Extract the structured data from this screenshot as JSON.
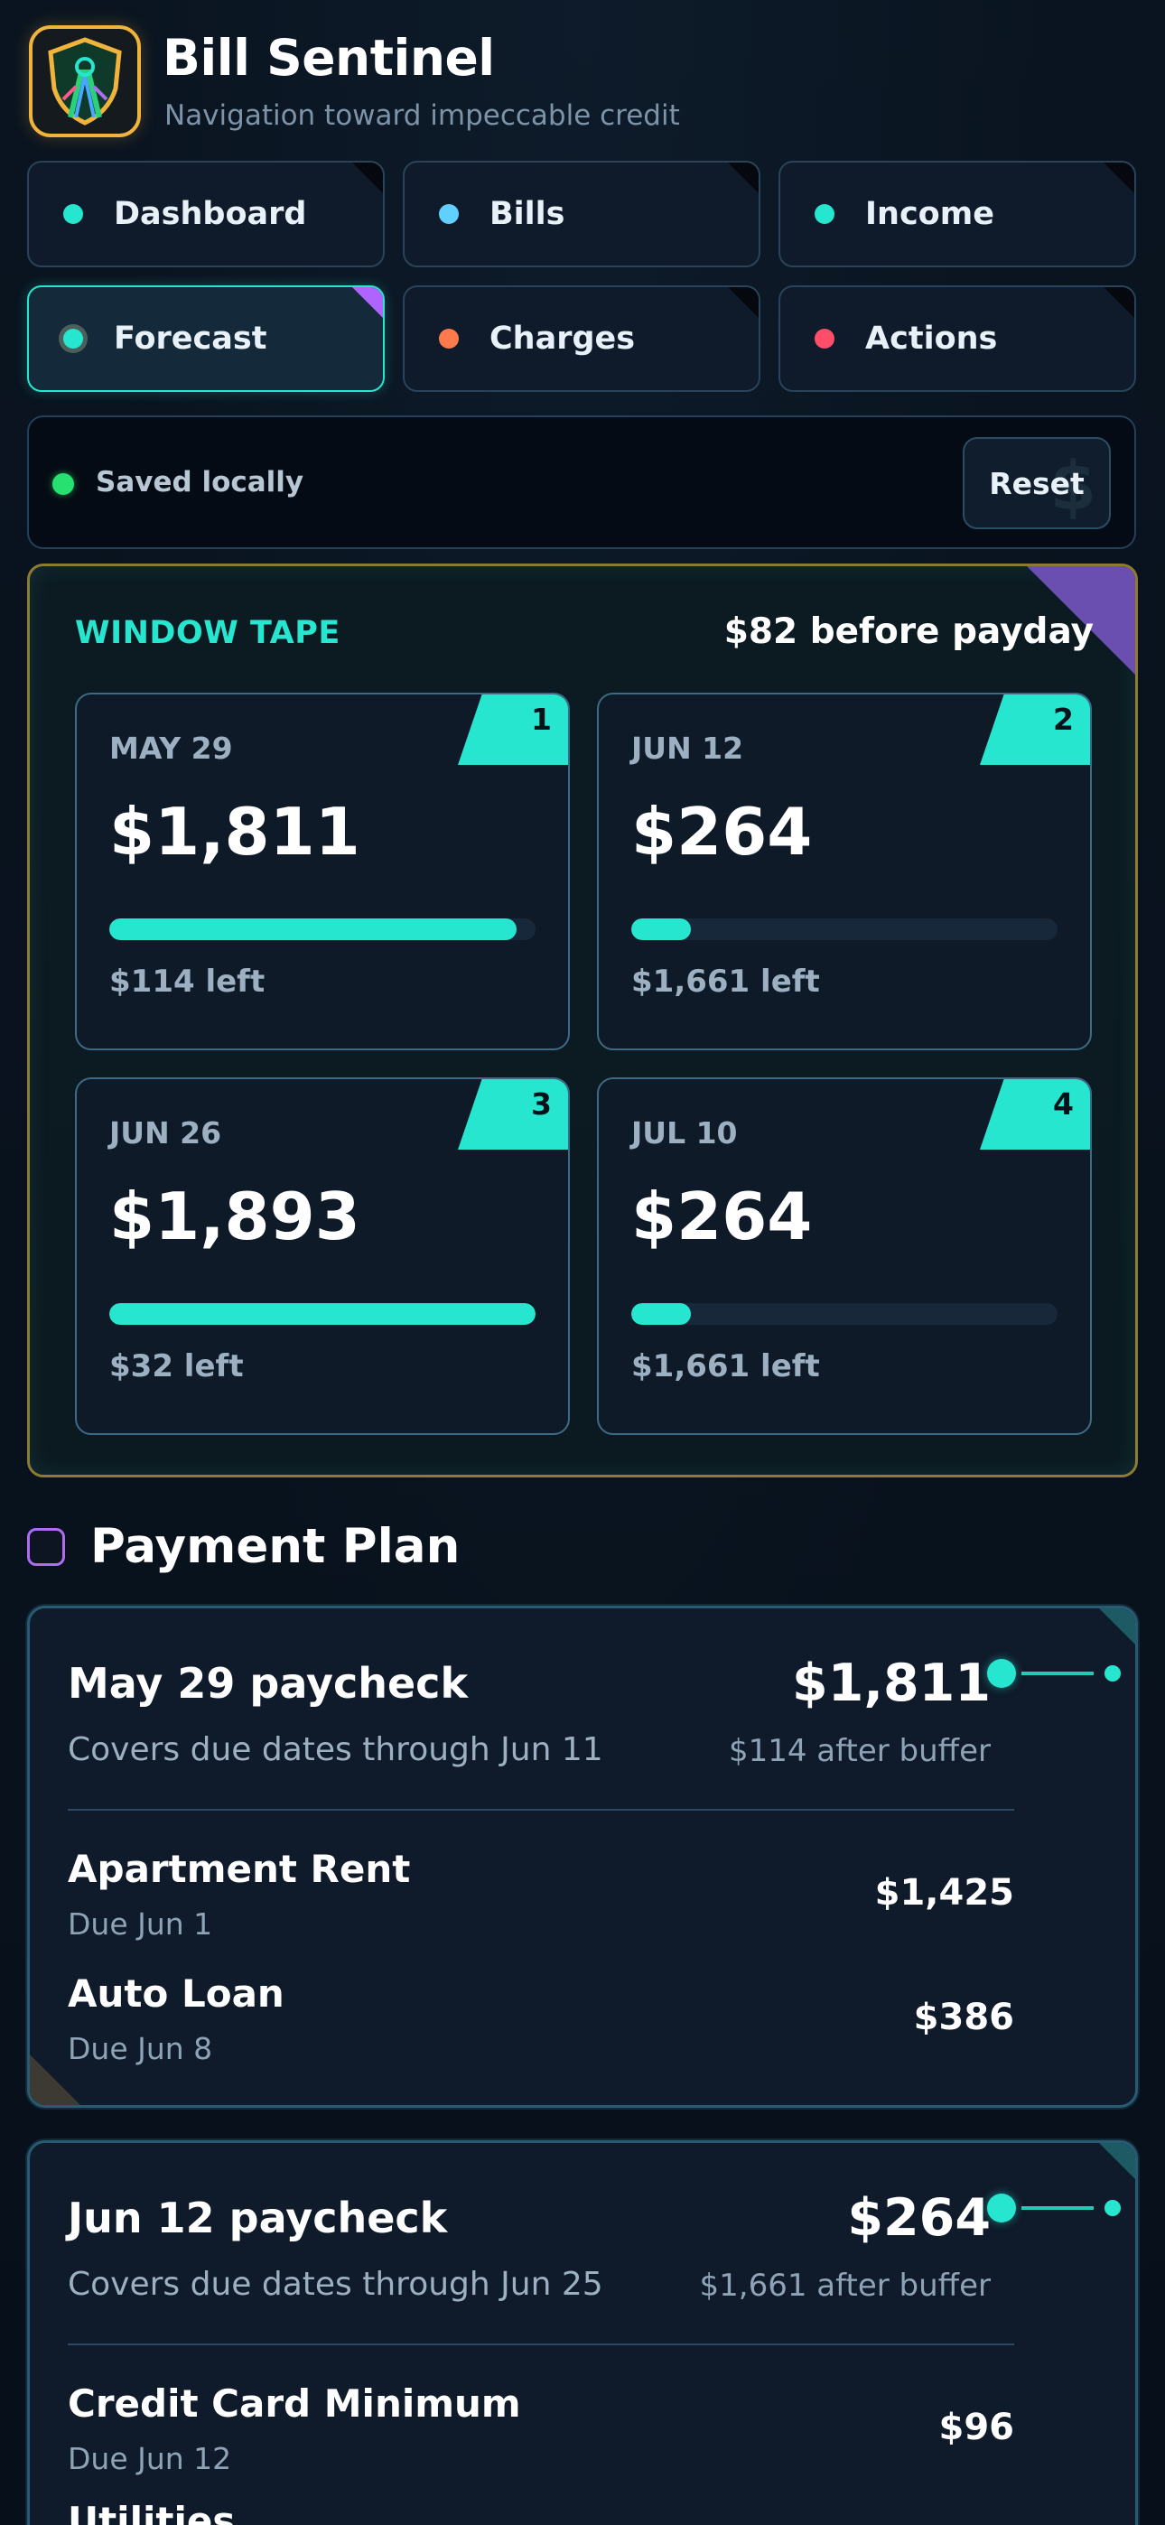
{
  "header": {
    "title": "Bill Sentinel",
    "subtitle": "Navigation toward impeccable credit",
    "logo_icon": "shield-road-icon"
  },
  "nav": {
    "items": [
      {
        "label": "Dashboard",
        "dot_color": "#27e6cf",
        "active": false
      },
      {
        "label": "Bills",
        "dot_color": "#5fd0ff",
        "active": false
      },
      {
        "label": "Income",
        "dot_color": "#27e6cf",
        "active": false
      },
      {
        "label": "Forecast",
        "dot_color": "#27e6cf",
        "active": true
      },
      {
        "label": "Charges",
        "dot_color": "#ff7a4a",
        "active": false
      },
      {
        "label": "Actions",
        "dot_color": "#ff4d6a",
        "active": false
      }
    ]
  },
  "status": {
    "text": "Saved locally",
    "reset_label": "Reset",
    "reset_icon": "$"
  },
  "window_tape": {
    "title": "WINDOW TAPE",
    "summary": "$82 before payday",
    "windows": [
      {
        "number": "1",
        "date": "MAY 29",
        "amount": "$1,811",
        "left": "$114 left",
        "used_fraction": 0.955
      },
      {
        "number": "2",
        "date": "JUN 12",
        "amount": "$264",
        "left": "$1,661 left",
        "used_fraction": 0.14
      },
      {
        "number": "3",
        "date": "JUN 26",
        "amount": "$1,893",
        "left": "$32 left",
        "used_fraction": 1.0
      },
      {
        "number": "4",
        "date": "JUL 10",
        "amount": "$264",
        "left": "$1,661 left",
        "used_fraction": 0.14
      }
    ]
  },
  "payment_plan": {
    "title": "Payment Plan",
    "cards": [
      {
        "title": "May 29 paycheck",
        "subtitle": "Covers due dates through Jun 11",
        "amount": "$1,811",
        "after_buffer": "$114 after buffer",
        "bills": [
          {
            "name": "Apartment Rent",
            "due": "Due Jun 1",
            "amount": "$1,425"
          },
          {
            "name": "Auto Loan",
            "due": "Due Jun 8",
            "amount": "$386"
          }
        ]
      },
      {
        "title": "Jun 12 paycheck",
        "subtitle": "Covers due dates through Jun 25",
        "amount": "$264",
        "after_buffer": "$1,661 after buffer",
        "bills": [
          {
            "name": "Credit Card Minimum",
            "due": "Due Jun 12",
            "amount": "$96"
          },
          {
            "name": "Utilities",
            "due": "",
            "amount": ""
          }
        ]
      }
    ]
  }
}
